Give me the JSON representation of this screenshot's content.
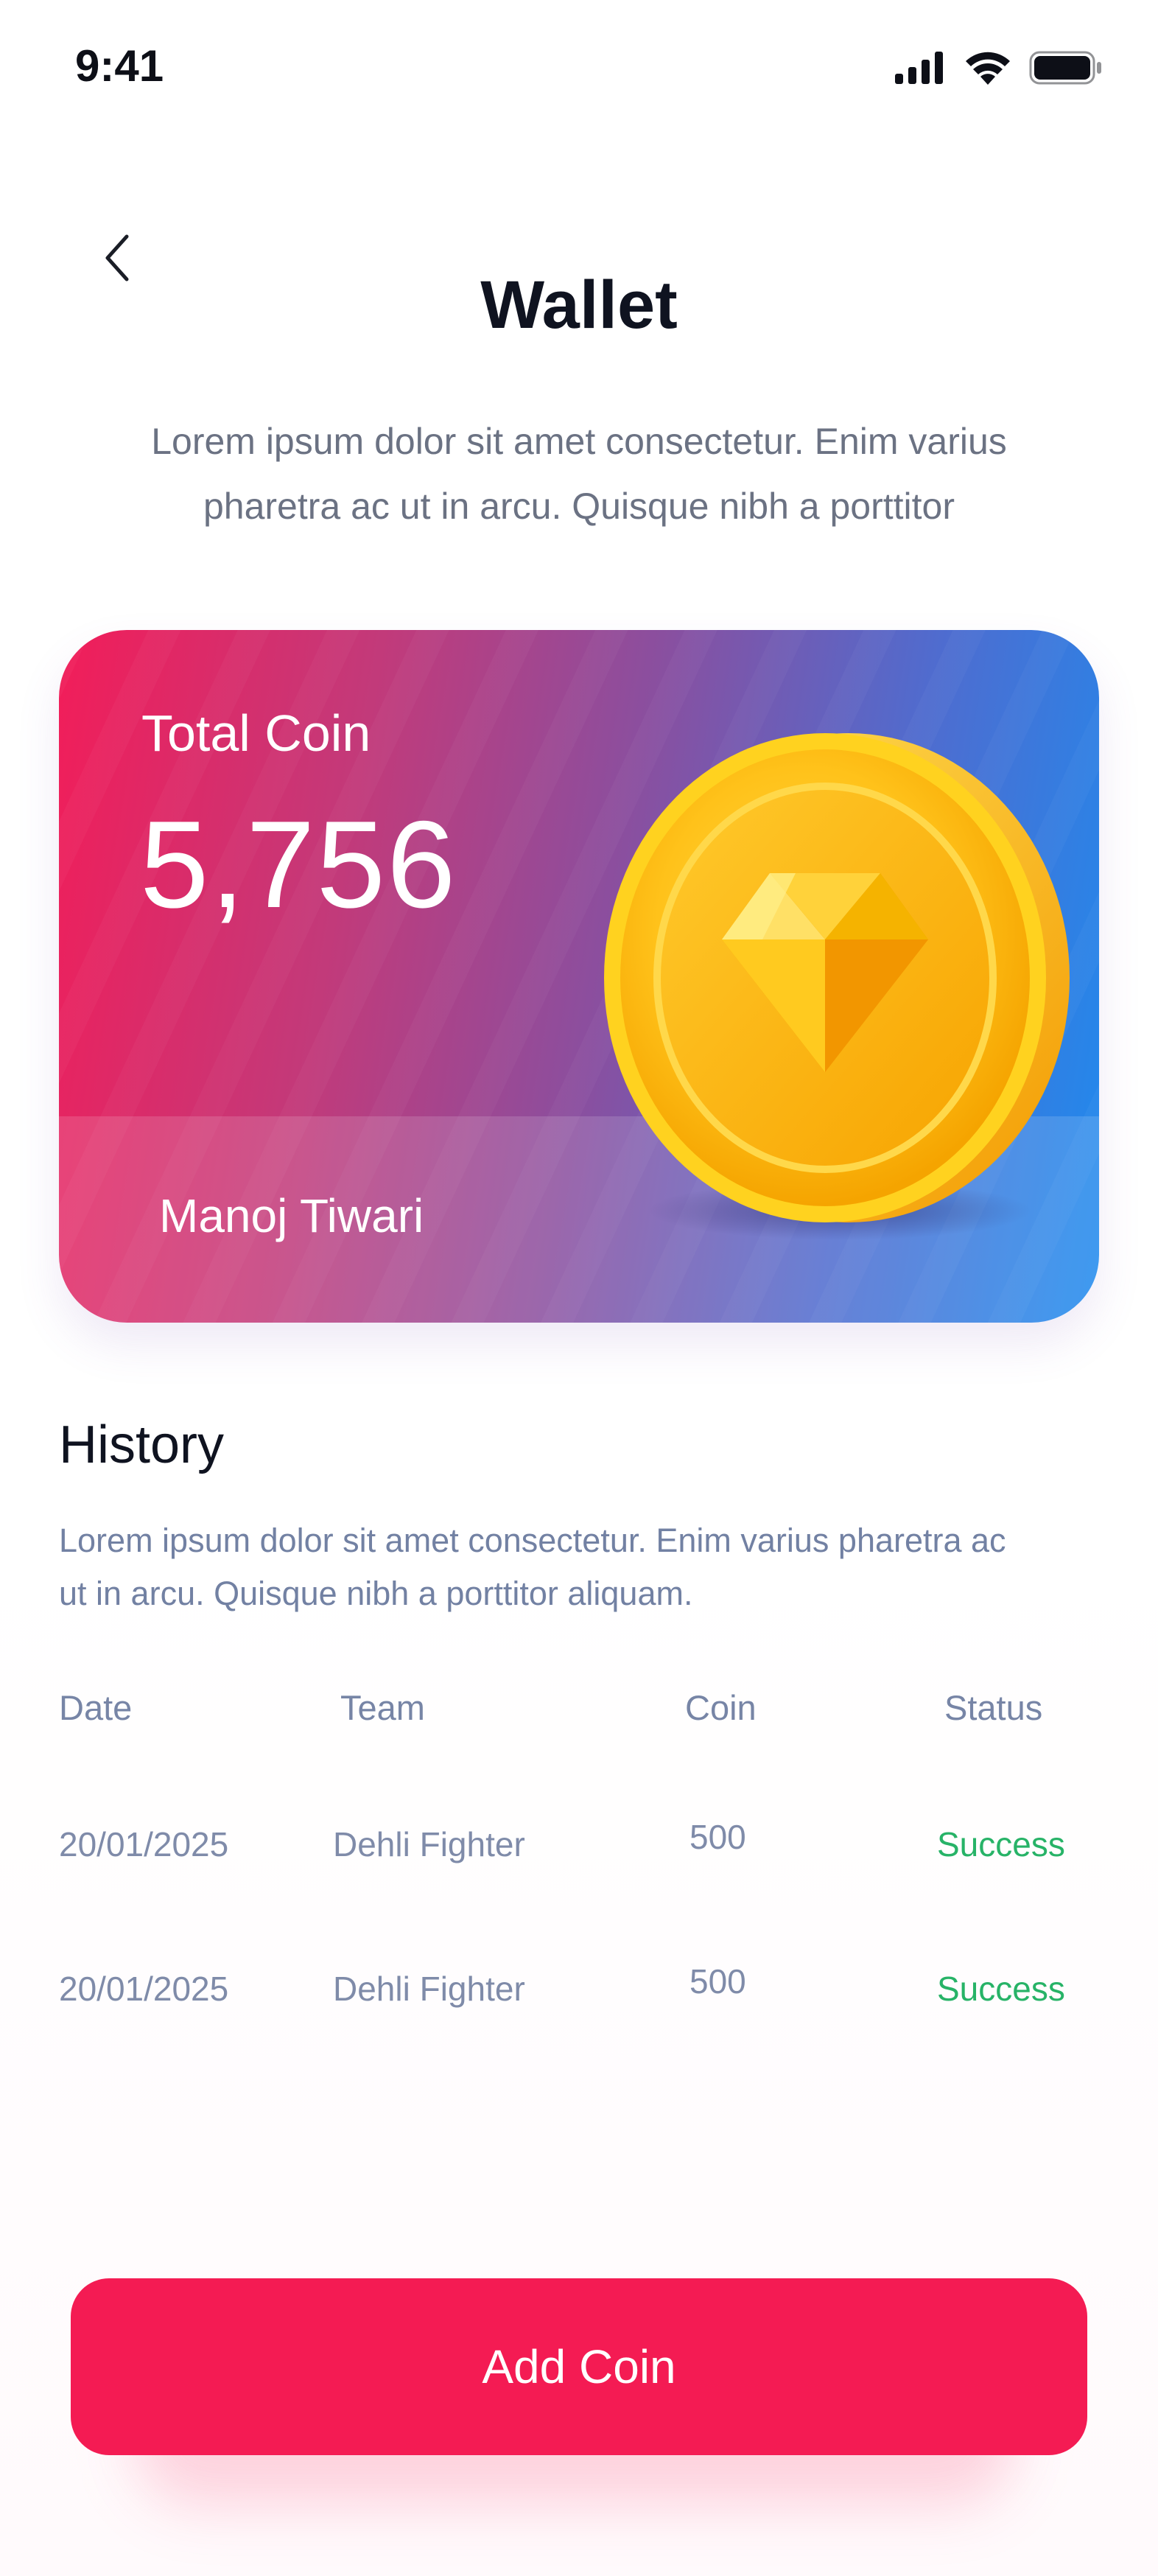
{
  "status_bar": {
    "time": "9:41",
    "icons": [
      "cellular-signal-icon",
      "wifi-icon",
      "battery-icon"
    ]
  },
  "header": {
    "back_icon": "chevron-left-icon",
    "title": "Wallet",
    "subtitle": "Lorem ipsum dolor sit amet consectetur. Enim varius pharetra ac ut in arcu. Quisque nibh a porttitor"
  },
  "wallet_card": {
    "label": "Total Coin",
    "value": "5,756",
    "owner": "Manoj Tiwari",
    "coin_icon": "diamond-coin-icon",
    "gradient_colors": [
      "#f21d59",
      "#8a4f9f",
      "#1e8bef"
    ]
  },
  "history": {
    "title": "History",
    "description": "Lorem ipsum dolor sit amet consectetur. Enim varius pharetra ac ut in arcu. Quisque nibh a porttitor aliquam.",
    "columns": [
      "Date",
      "Team",
      "Coin",
      "Status"
    ],
    "rows": [
      {
        "date": "20/01/2025",
        "team": "Dehli Fighter",
        "coin": "500",
        "status": "Success"
      },
      {
        "date": "20/01/2025",
        "team": "Dehli Fighter",
        "coin": "500",
        "status": "Success"
      }
    ]
  },
  "cta": {
    "label": "Add Coin"
  },
  "colors": {
    "accent": "#f41b53",
    "success": "#27b367",
    "muted_text": "#7281a3"
  }
}
